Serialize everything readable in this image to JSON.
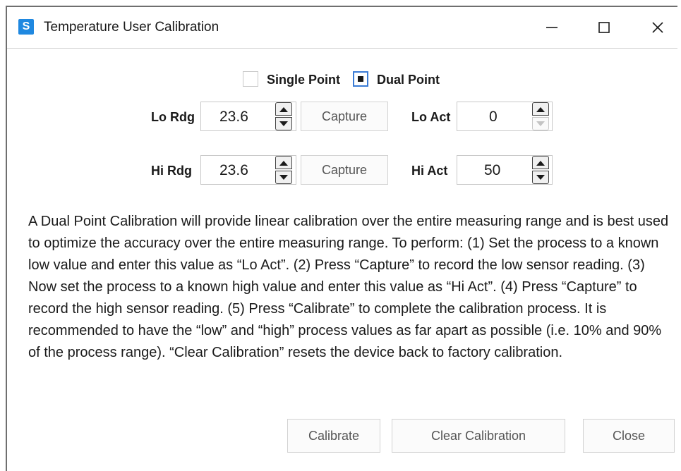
{
  "window": {
    "title": "Temperature User Calibration",
    "app_icon_glyph": "S",
    "accent_color": "#1f88e0"
  },
  "mode": {
    "single_label": "Single Point",
    "single_checked": false,
    "dual_label": "Dual Point",
    "dual_checked": true
  },
  "fields": {
    "lo_rdg": {
      "label": "Lo Rdg",
      "value": "23.6",
      "capture_label": "Capture"
    },
    "hi_rdg": {
      "label": "Hi Rdg",
      "value": "23.6",
      "capture_label": "Capture"
    },
    "lo_act": {
      "label": "Lo Act",
      "value": "0"
    },
    "hi_act": {
      "label": "Hi Act",
      "value": "50"
    }
  },
  "description": "A Dual Point Calibration will provide linear calibration over the entire measuring range and is best used to optimize the accuracy over the entire measuring range. To perform: (1) Set the process to a known low value and enter this value as “Lo Act”. (2) Press “Capture” to record the low sensor reading. (3) Now set the process to a known high value and enter this value as “Hi Act”. (4) Press “Capture” to record the high sensor reading. (5) Press “Calibrate” to complete the calibration process. It is recommended to have the “low” and “high” process values as far apart as possible (i.e. 10% and 90% of the process range). “Clear Calibration” resets the device back to factory calibration.",
  "buttons": {
    "calibrate": "Calibrate",
    "clear_calibration": "Clear Calibration",
    "close": "Close"
  }
}
